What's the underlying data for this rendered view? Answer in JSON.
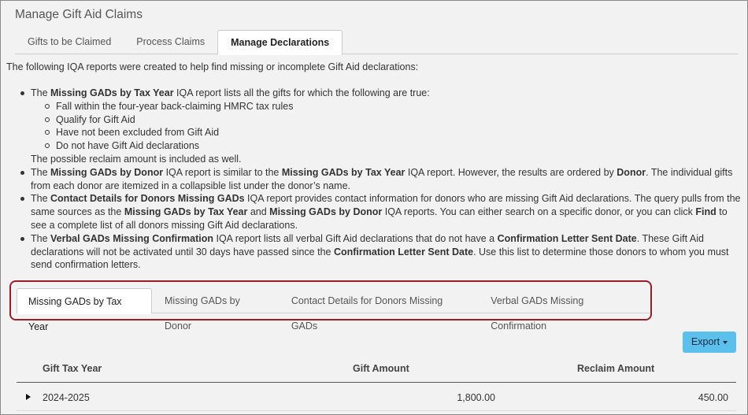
{
  "page": {
    "title": "Manage Gift Aid Claims"
  },
  "top_tabs": [
    {
      "label": "Gifts to be Claimed"
    },
    {
      "label": "Process Claims"
    },
    {
      "label": "Manage Declarations"
    }
  ],
  "intro": "The following IQA reports were created to help find missing or incomplete Gift Aid declarations:",
  "bullets": {
    "b1": {
      "t1": "The ",
      "k1": "Missing GADs by Tax Year",
      "t2": " IQA report lists all the gifts for which the following are true:",
      "sub": [
        "Fall within the four-year back-claiming HMRC tax rules",
        "Qualify for Gift Aid",
        "Have not been excluded from Gift Aid",
        "Do not have Gift Aid declarations"
      ],
      "after": "The possible reclaim amount is included as well."
    },
    "b2": {
      "t1": "The ",
      "k1": "Missing GADs by Donor",
      "t2": " IQA report is similar to the ",
      "k2": "Missing GADs by Tax Year",
      "t3": " IQA report. However, the results are ordered by ",
      "k3": "Donor",
      "t4": ". The individual gifts from each donor are itemized in a collapsible list under the donor’s name."
    },
    "b3": {
      "t1": "The ",
      "k1": "Contact Details for Donors Missing GADs",
      "t2": " IQA report provides contact information for donors who are missing Gift Aid declarations. The query pulls from the same sources as the ",
      "k2": "Missing GADs by Tax Year",
      "t3": " and ",
      "k3": "Missing GADs by Donor",
      "t4": " IQA reports. You can either search on a specific donor, or you can click ",
      "k4": "Find",
      "t5": " to see a complete list of all donors missing Gift Aid declarations."
    },
    "b4": {
      "t1": "The ",
      "k1": "Verbal GADs Missing Confirmation",
      "t2": " IQA report lists all verbal Gift Aid declarations that do not have a ",
      "k2": "Confirmation Letter Sent Date",
      "t3": ". These Gift Aid declarations will not be activated until 30 days have passed since the ",
      "k3": "Confirmation Letter Sent Date",
      "t4": ". Use this list to determine those donors to whom you must send confirmation letters."
    }
  },
  "report_tabs": [
    {
      "label": "Missing GADs by Tax Year"
    },
    {
      "label": "Missing GADs by Donor"
    },
    {
      "label": "Contact Details for Donors Missing GADs"
    },
    {
      "label": "Verbal GADs Missing Confirmation"
    }
  ],
  "export": {
    "label": "Export"
  },
  "table": {
    "headers": {
      "year": "Gift Tax Year",
      "amount": "Gift Amount",
      "reclaim": "Reclaim Amount"
    },
    "rows": [
      {
        "year": "2024-2025",
        "amount": "1,800.00",
        "reclaim": "450.00"
      }
    ]
  },
  "colors": {
    "highlight_border": "#9b1c2a",
    "export_button": "#5bc0ec"
  }
}
